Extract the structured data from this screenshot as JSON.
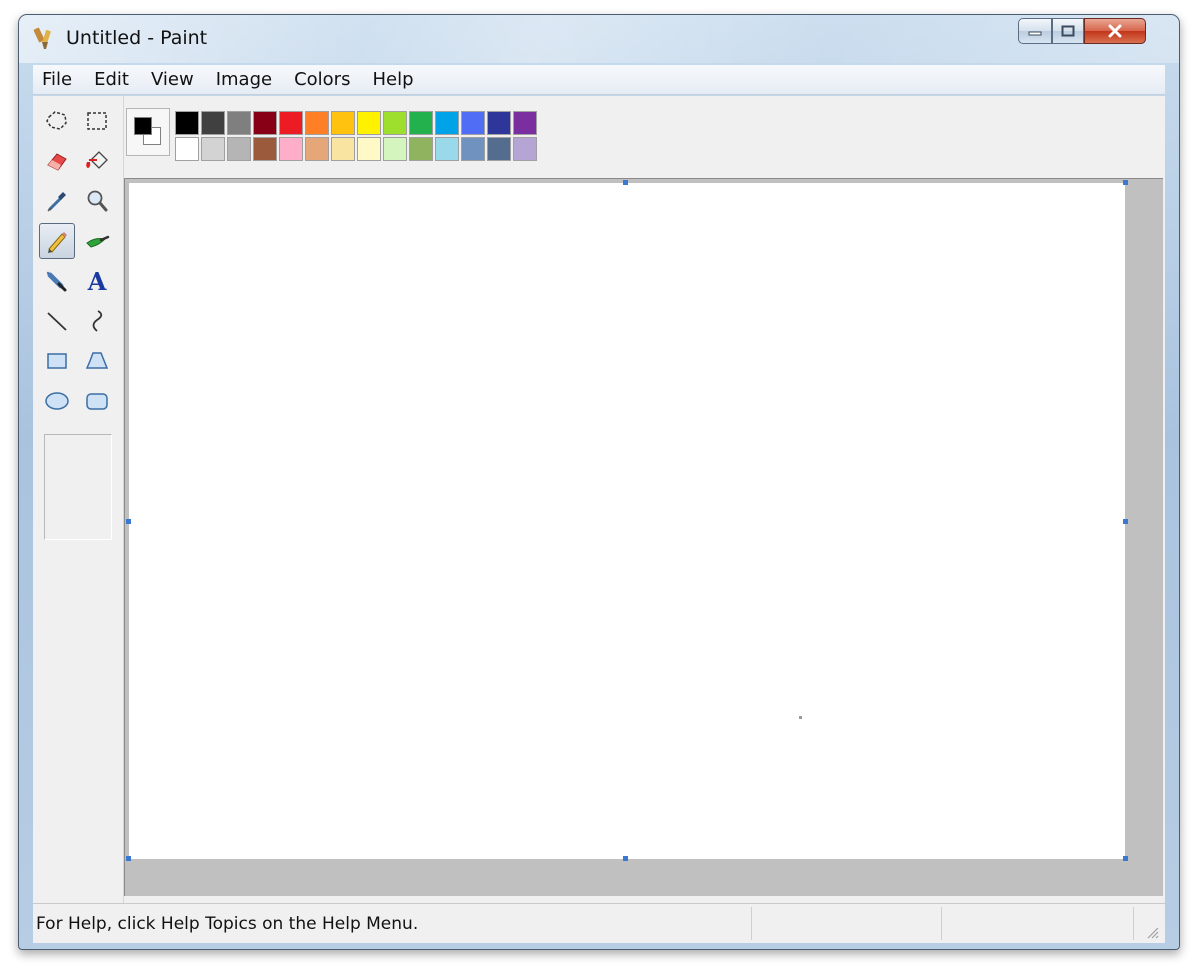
{
  "window": {
    "title": "Untitled - Paint",
    "controls": [
      "minimize-button",
      "maximize-button",
      "close-button"
    ]
  },
  "menu": {
    "items": [
      "File",
      "Edit",
      "View",
      "Image",
      "Colors",
      "Help"
    ]
  },
  "toolbox": {
    "tools": [
      {
        "name": "free-form-select",
        "icon": "free-form-select-icon"
      },
      {
        "name": "select",
        "icon": "rectangle-select-icon"
      },
      {
        "name": "eraser",
        "icon": "eraser-icon"
      },
      {
        "name": "fill-with-color",
        "icon": "paint-bucket-icon"
      },
      {
        "name": "pick-color",
        "icon": "eyedropper-icon"
      },
      {
        "name": "magnifier",
        "icon": "magnifier-icon"
      },
      {
        "name": "pencil",
        "icon": "pencil-icon",
        "selected": true
      },
      {
        "name": "brush",
        "icon": "brush-icon"
      },
      {
        "name": "airbrush",
        "icon": "airbrush-icon"
      },
      {
        "name": "text",
        "icon": "text-icon",
        "glyph": "A"
      },
      {
        "name": "line",
        "icon": "line-icon"
      },
      {
        "name": "curve",
        "icon": "curve-icon"
      },
      {
        "name": "rectangle",
        "icon": "rectangle-icon"
      },
      {
        "name": "polygon",
        "icon": "polygon-icon"
      },
      {
        "name": "ellipse",
        "icon": "ellipse-icon"
      },
      {
        "name": "rounded-rectangle",
        "icon": "rounded-rectangle-icon"
      }
    ]
  },
  "colors": {
    "foreground": "#000000",
    "background": "#ffffff",
    "palette_row1": [
      "#000000",
      "#404040",
      "#7f7f7f",
      "#880015",
      "#ed1c24",
      "#ff7f27",
      "#ffc20e",
      "#fff200",
      "#9ede2d",
      "#22b14c",
      "#00a2e8",
      "#4f6df5",
      "#2f3699",
      "#7b2ea0"
    ],
    "palette_row2": [
      "#ffffff",
      "#d3d3d3",
      "#b5b5b5",
      "#9c5a3c",
      "#ffaec9",
      "#e5a77a",
      "#f9e4a2",
      "#fff9c8",
      "#d4f5bd",
      "#90b360",
      "#99d9ea",
      "#7092be",
      "#546d8e",
      "#b5a5d5"
    ]
  },
  "status": {
    "help_text": "For Help, click Help Topics on the Help Menu."
  }
}
